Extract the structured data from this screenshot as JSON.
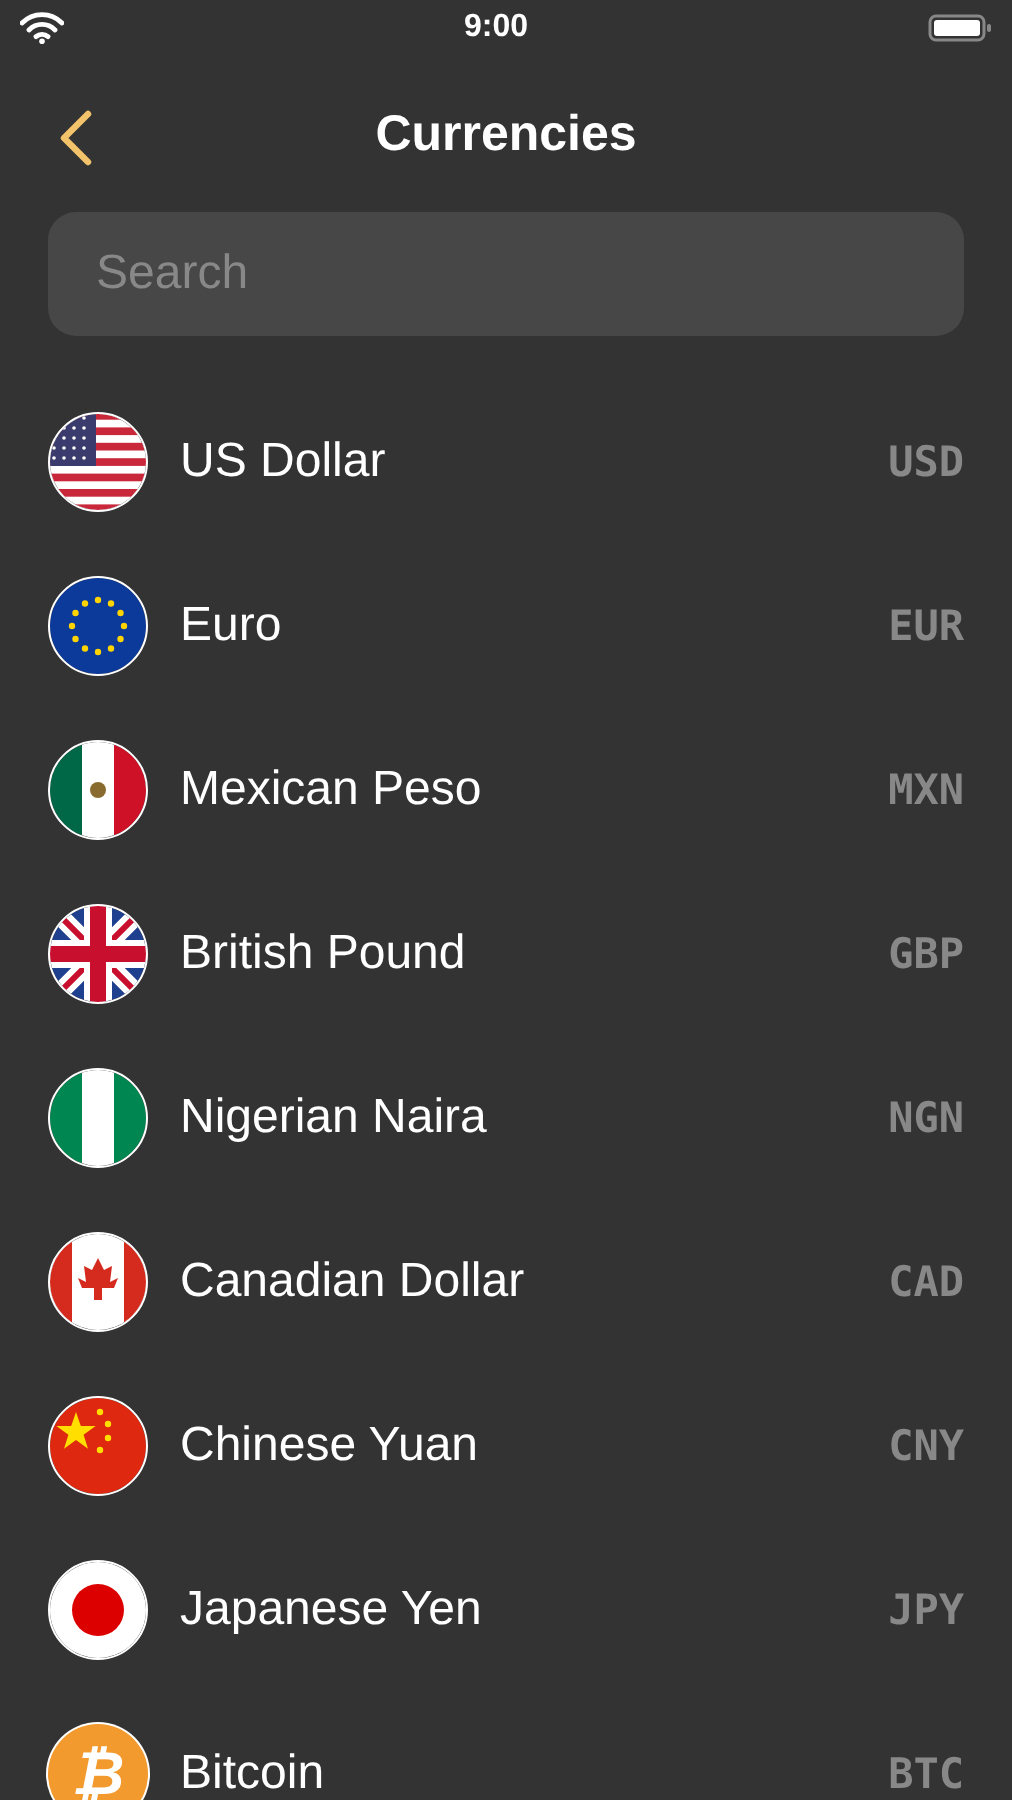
{
  "status_bar": {
    "time": "9:00"
  },
  "nav": {
    "title": "Currencies"
  },
  "search": {
    "placeholder": "Search"
  },
  "currencies": [
    {
      "kind": "us",
      "name": "US Dollar",
      "code": "USD"
    },
    {
      "kind": "eu",
      "name": "Euro",
      "code": "EUR"
    },
    {
      "kind": "mx",
      "name": "Mexican Peso",
      "code": "MXN"
    },
    {
      "kind": "gb",
      "name": "British Pound",
      "code": "GBP"
    },
    {
      "kind": "ng",
      "name": "Nigerian Naira",
      "code": "NGN"
    },
    {
      "kind": "ca",
      "name": "Canadian Dollar",
      "code": "CAD"
    },
    {
      "kind": "cn",
      "name": "Chinese Yuan",
      "code": "CNY"
    },
    {
      "kind": "jp",
      "name": "Japanese Yen",
      "code": "JPY"
    },
    {
      "kind": "coin",
      "symbol": "₿",
      "name": "Bitcoin",
      "code": "BTC"
    }
  ]
}
